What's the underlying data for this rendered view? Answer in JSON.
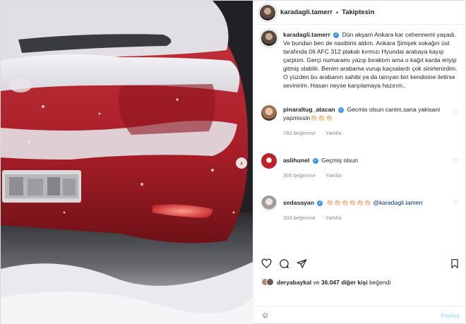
{
  "post": {
    "image_alt": "",
    "next_icon": "chevron-right-icon"
  },
  "header": {
    "username": "karadagli.tamerr",
    "separator": "•",
    "follow_status": "Takiptesin"
  },
  "caption": {
    "username": "karadagli.tamerr",
    "text": "Dün akşam Ankara kar cehennemi yaşadı. Ve bundan ben de nasibimi aldım. Ankara Şimşek sokağın üst tarafında 06 AFC 312 plakalı kırmızı Hyundai arabaya kayıp çarptım. Gerçi numaramı yazıp bıraktım ama o kağıt karda eriyip gitmiş olabilir. Benim arabama vurup kaçsalardı çok sinirlenirdim. O yüzden bu arabanın sahibi ya da tanıyan biri kendisine iletirse sevinirim. Hasarı neyse karşılamaya hazırım.."
  },
  "comments": [
    {
      "username": "pinaraltug_atacan",
      "verified": true,
      "text": "Gecmis olsun canim,sana yakisani yapmissin👏🏻👏🏻👏🏻",
      "likes": "783 beğenme",
      "reply": "Yanıtla",
      "avatar_color": "#d9b89a"
    },
    {
      "username": "aslihunel",
      "verified": true,
      "text": "Geçmiş olsun",
      "likes": "365 beğenme",
      "reply": "Yanıtla",
      "avatar_color": "#c0202a"
    },
    {
      "username": "sedasayan",
      "verified": true,
      "text": "👏🏻👏🏻👏🏻👏🏻👏🏻👏🏻",
      "mention": "@karadagli.tamerr",
      "likes": "333 beğenme",
      "reply": "Yanıtla",
      "avatar_color": "#bdbdbd"
    }
  ],
  "likes": {
    "user": "deryabaykal",
    "connector": "ve",
    "others": "36.047 diğer kişi",
    "suffix": "beğendi"
  },
  "composer": {
    "placeholder": "",
    "post_label": "Paylaş"
  },
  "colors": {
    "verified": "#3897f0",
    "muted": "#8e8e8e",
    "car": "#b3212b",
    "post_button": "#b2dffc"
  }
}
